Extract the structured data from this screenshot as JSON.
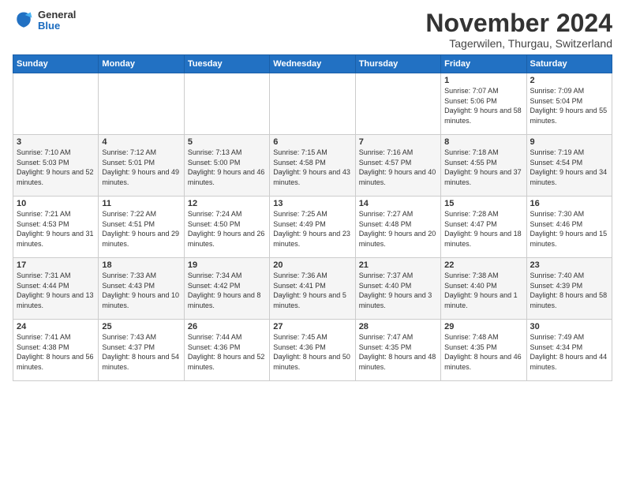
{
  "logo": {
    "general": "General",
    "blue": "Blue"
  },
  "title": "November 2024",
  "location": "Tagerwilen, Thurgau, Switzerland",
  "weekdays": [
    "Sunday",
    "Monday",
    "Tuesday",
    "Wednesday",
    "Thursday",
    "Friday",
    "Saturday"
  ],
  "weeks": [
    [
      null,
      null,
      null,
      null,
      null,
      {
        "day": "1",
        "sunrise": "Sunrise: 7:07 AM",
        "sunset": "Sunset: 5:06 PM",
        "daylight": "Daylight: 9 hours and 58 minutes."
      },
      {
        "day": "2",
        "sunrise": "Sunrise: 7:09 AM",
        "sunset": "Sunset: 5:04 PM",
        "daylight": "Daylight: 9 hours and 55 minutes."
      }
    ],
    [
      {
        "day": "3",
        "sunrise": "Sunrise: 7:10 AM",
        "sunset": "Sunset: 5:03 PM",
        "daylight": "Daylight: 9 hours and 52 minutes."
      },
      {
        "day": "4",
        "sunrise": "Sunrise: 7:12 AM",
        "sunset": "Sunset: 5:01 PM",
        "daylight": "Daylight: 9 hours and 49 minutes."
      },
      {
        "day": "5",
        "sunrise": "Sunrise: 7:13 AM",
        "sunset": "Sunset: 5:00 PM",
        "daylight": "Daylight: 9 hours and 46 minutes."
      },
      {
        "day": "6",
        "sunrise": "Sunrise: 7:15 AM",
        "sunset": "Sunset: 4:58 PM",
        "daylight": "Daylight: 9 hours and 43 minutes."
      },
      {
        "day": "7",
        "sunrise": "Sunrise: 7:16 AM",
        "sunset": "Sunset: 4:57 PM",
        "daylight": "Daylight: 9 hours and 40 minutes."
      },
      {
        "day": "8",
        "sunrise": "Sunrise: 7:18 AM",
        "sunset": "Sunset: 4:55 PM",
        "daylight": "Daylight: 9 hours and 37 minutes."
      },
      {
        "day": "9",
        "sunrise": "Sunrise: 7:19 AM",
        "sunset": "Sunset: 4:54 PM",
        "daylight": "Daylight: 9 hours and 34 minutes."
      }
    ],
    [
      {
        "day": "10",
        "sunrise": "Sunrise: 7:21 AM",
        "sunset": "Sunset: 4:53 PM",
        "daylight": "Daylight: 9 hours and 31 minutes."
      },
      {
        "day": "11",
        "sunrise": "Sunrise: 7:22 AM",
        "sunset": "Sunset: 4:51 PM",
        "daylight": "Daylight: 9 hours and 29 minutes."
      },
      {
        "day": "12",
        "sunrise": "Sunrise: 7:24 AM",
        "sunset": "Sunset: 4:50 PM",
        "daylight": "Daylight: 9 hours and 26 minutes."
      },
      {
        "day": "13",
        "sunrise": "Sunrise: 7:25 AM",
        "sunset": "Sunset: 4:49 PM",
        "daylight": "Daylight: 9 hours and 23 minutes."
      },
      {
        "day": "14",
        "sunrise": "Sunrise: 7:27 AM",
        "sunset": "Sunset: 4:48 PM",
        "daylight": "Daylight: 9 hours and 20 minutes."
      },
      {
        "day": "15",
        "sunrise": "Sunrise: 7:28 AM",
        "sunset": "Sunset: 4:47 PM",
        "daylight": "Daylight: 9 hours and 18 minutes."
      },
      {
        "day": "16",
        "sunrise": "Sunrise: 7:30 AM",
        "sunset": "Sunset: 4:46 PM",
        "daylight": "Daylight: 9 hours and 15 minutes."
      }
    ],
    [
      {
        "day": "17",
        "sunrise": "Sunrise: 7:31 AM",
        "sunset": "Sunset: 4:44 PM",
        "daylight": "Daylight: 9 hours and 13 minutes."
      },
      {
        "day": "18",
        "sunrise": "Sunrise: 7:33 AM",
        "sunset": "Sunset: 4:43 PM",
        "daylight": "Daylight: 9 hours and 10 minutes."
      },
      {
        "day": "19",
        "sunrise": "Sunrise: 7:34 AM",
        "sunset": "Sunset: 4:42 PM",
        "daylight": "Daylight: 9 hours and 8 minutes."
      },
      {
        "day": "20",
        "sunrise": "Sunrise: 7:36 AM",
        "sunset": "Sunset: 4:41 PM",
        "daylight": "Daylight: 9 hours and 5 minutes."
      },
      {
        "day": "21",
        "sunrise": "Sunrise: 7:37 AM",
        "sunset": "Sunset: 4:40 PM",
        "daylight": "Daylight: 9 hours and 3 minutes."
      },
      {
        "day": "22",
        "sunrise": "Sunrise: 7:38 AM",
        "sunset": "Sunset: 4:40 PM",
        "daylight": "Daylight: 9 hours and 1 minute."
      },
      {
        "day": "23",
        "sunrise": "Sunrise: 7:40 AM",
        "sunset": "Sunset: 4:39 PM",
        "daylight": "Daylight: 8 hours and 58 minutes."
      }
    ],
    [
      {
        "day": "24",
        "sunrise": "Sunrise: 7:41 AM",
        "sunset": "Sunset: 4:38 PM",
        "daylight": "Daylight: 8 hours and 56 minutes."
      },
      {
        "day": "25",
        "sunrise": "Sunrise: 7:43 AM",
        "sunset": "Sunset: 4:37 PM",
        "daylight": "Daylight: 8 hours and 54 minutes."
      },
      {
        "day": "26",
        "sunrise": "Sunrise: 7:44 AM",
        "sunset": "Sunset: 4:36 PM",
        "daylight": "Daylight: 8 hours and 52 minutes."
      },
      {
        "day": "27",
        "sunrise": "Sunrise: 7:45 AM",
        "sunset": "Sunset: 4:36 PM",
        "daylight": "Daylight: 8 hours and 50 minutes."
      },
      {
        "day": "28",
        "sunrise": "Sunrise: 7:47 AM",
        "sunset": "Sunset: 4:35 PM",
        "daylight": "Daylight: 8 hours and 48 minutes."
      },
      {
        "day": "29",
        "sunrise": "Sunrise: 7:48 AM",
        "sunset": "Sunset: 4:35 PM",
        "daylight": "Daylight: 8 hours and 46 minutes."
      },
      {
        "day": "30",
        "sunrise": "Sunrise: 7:49 AM",
        "sunset": "Sunset: 4:34 PM",
        "daylight": "Daylight: 8 hours and 44 minutes."
      }
    ]
  ]
}
